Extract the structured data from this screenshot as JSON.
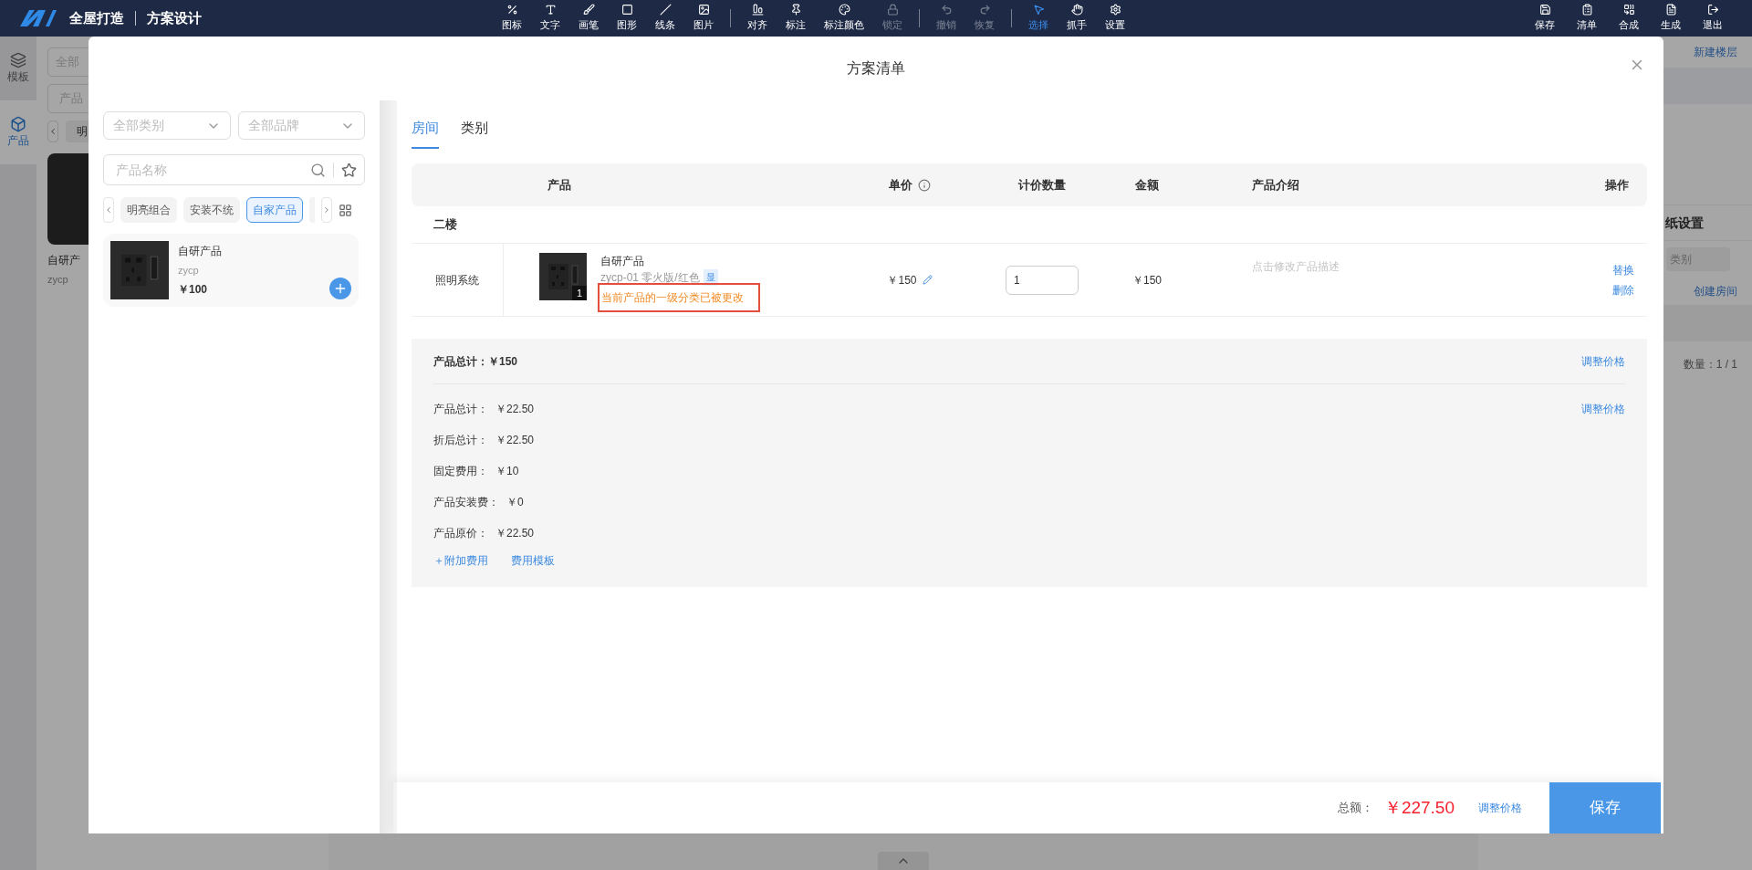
{
  "top_bar": {
    "brand": "全屋打造",
    "section": "方案设计",
    "tool_groups": [
      [
        {
          "label": "图标",
          "disabled": false,
          "selected": false
        },
        {
          "label": "文字",
          "disabled": false,
          "selected": false
        },
        {
          "label": "画笔",
          "disabled": false,
          "selected": false
        },
        {
          "label": "图形",
          "disabled": false,
          "selected": false
        },
        {
          "label": "线条",
          "disabled": false,
          "selected": false
        },
        {
          "label": "图片",
          "disabled": false,
          "selected": false
        }
      ],
      [
        {
          "label": "对齐",
          "disabled": false,
          "selected": false
        },
        {
          "label": "标注",
          "disabled": false,
          "selected": false
        },
        {
          "label": "标注颜色",
          "disabled": false,
          "selected": false
        },
        {
          "label": "锁定",
          "disabled": true,
          "selected": false
        }
      ],
      [
        {
          "label": "撤销",
          "disabled": true,
          "selected": false
        },
        {
          "label": "恢复",
          "disabled": true,
          "selected": false
        }
      ],
      [
        {
          "label": "选择",
          "disabled": false,
          "selected": true
        },
        {
          "label": "抓手",
          "disabled": false,
          "selected": false
        },
        {
          "label": "设置",
          "disabled": false,
          "selected": false
        }
      ]
    ],
    "actions": [
      "保存",
      "清单",
      "合成",
      "生成",
      "退出"
    ]
  },
  "background": {
    "sidebar": [
      {
        "label": "模板",
        "selected": false
      },
      {
        "label": "产品",
        "selected": true
      }
    ],
    "category_field": "全部",
    "name_field": "产品",
    "chip": "明",
    "card_title": "自研产",
    "card_code": "zycp",
    "right_panel": {
      "new_floor": "新建楼层",
      "drawing_settings": "纸设置",
      "category_field": "类别",
      "create_room": "创建房间",
      "count": "数量：1 / 1"
    }
  },
  "dialog": {
    "title": "方案清单",
    "filters": {
      "category": "全部类别",
      "brand": "全部品牌",
      "search_placeholder": "产品名称",
      "chips": [
        {
          "label": "明亮组合",
          "selected": false
        },
        {
          "label": "安装不统",
          "selected": false
        },
        {
          "label": "自家产品",
          "selected": true
        }
      ]
    },
    "catalog": [
      {
        "name": "自研产品",
        "code": "zycp",
        "price": "￥100"
      }
    ],
    "tabs": [
      {
        "label": "房间",
        "selected": true
      },
      {
        "label": "类别",
        "selected": false
      }
    ],
    "table": {
      "columns": [
        "产品",
        "单价",
        "计价数量",
        "金额",
        "产品介绍",
        "操作"
      ],
      "floors": [
        {
          "name": "二楼",
          "rows": [
            {
              "room": "照明系统",
              "product": "自研产品",
              "spec": "zycp-01 零火版/红色",
              "tag": "显",
              "quantity_badge": "1",
              "warning": "当前产品的一级分类已被更改",
              "unit_price": "￥150",
              "quantity": "1",
              "amount": "￥150",
              "description_placeholder": "点击修改产品描述",
              "actions": [
                "替换",
                "删除"
              ]
            }
          ]
        }
      ]
    },
    "summary": {
      "headline": "产品总计：￥150",
      "adjust": "调整价格",
      "lines": [
        {
          "label": "产品总计：",
          "value": "￥22.50",
          "adjust": "调整价格"
        },
        {
          "label": "折后总计：",
          "value": "￥22.50"
        },
        {
          "label": "固定费用：",
          "value": "￥10"
        },
        {
          "label": "产品安装费：",
          "value": "￥0"
        },
        {
          "label": "产品原价：",
          "value": "￥22.50"
        }
      ],
      "links": [
        "＋附加费用",
        "费用模板"
      ]
    },
    "footer": {
      "total_label": "总额：",
      "total": "￥227.50",
      "adjust": "调整价格",
      "save": "保存"
    }
  }
}
